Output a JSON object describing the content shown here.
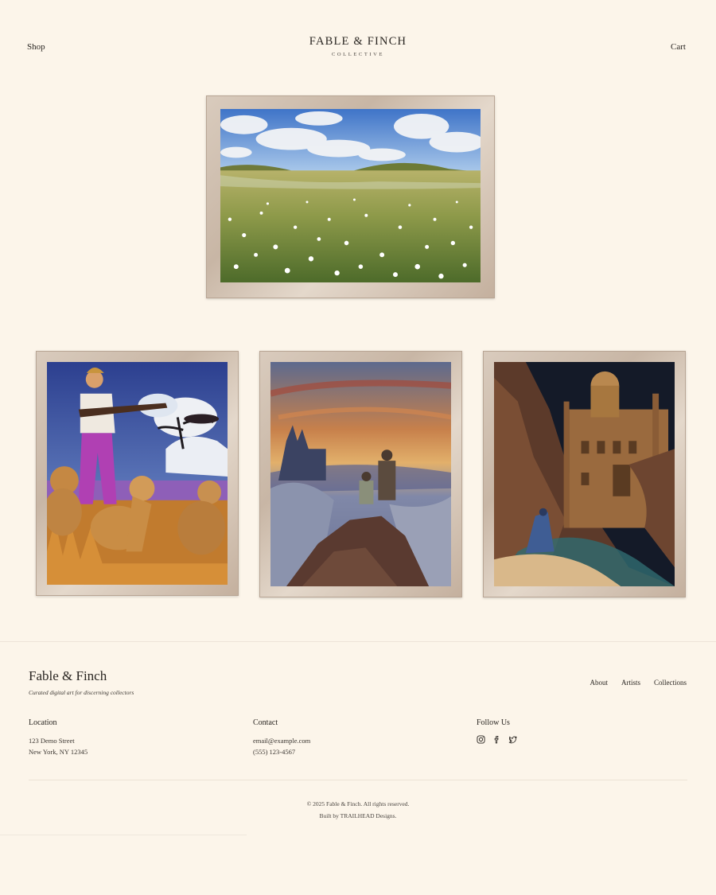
{
  "header": {
    "nav_left": "Shop",
    "nav_right": "Cart",
    "logo_title": "FABLE & FINCH",
    "logo_subtitle": "COLLECTIVE"
  },
  "gallery": {
    "featured": {
      "subject": "meadow-of-white-flowers-painting"
    },
    "items": [
      {
        "subject": "hunter-with-lions-painting"
      },
      {
        "subject": "figures-on-cliff-at-sunset-painting"
      },
      {
        "subject": "cloaked-figure-before-palace-painting"
      }
    ]
  },
  "footer": {
    "brand": "Fable & Finch",
    "tagline": "Curated digital art for discerning collectors",
    "links": [
      "About",
      "Artists",
      "Collections"
    ],
    "location": {
      "title": "Location",
      "line1": "123 Demo Street",
      "line2": "New York, NY 12345"
    },
    "contact": {
      "title": "Contact",
      "email": "email@example.com",
      "phone": "(555) 123-4567"
    },
    "follow": {
      "title": "Follow Us",
      "icons": [
        "instagram-icon",
        "facebook-icon",
        "twitter-icon"
      ]
    },
    "copyright": "© 2025 Fable & Finch. All rights reserved.",
    "built_by": "Built by TRAILHEAD Designs."
  },
  "colors": {
    "background": "#fcf5ea",
    "text": "#2a2622",
    "frame": "#d2c2b2"
  }
}
